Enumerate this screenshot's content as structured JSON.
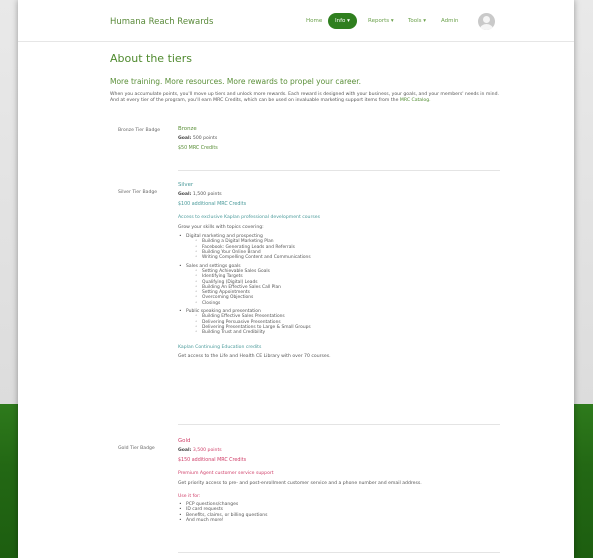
{
  "nav": {
    "brand": "Humana Reach Rewards",
    "items": [
      {
        "label": "Home"
      },
      {
        "label": "Info ▾"
      },
      {
        "label": "Reports ▾"
      },
      {
        "label": "Tools ▾"
      },
      {
        "label": "Admin"
      }
    ]
  },
  "page": {
    "title": "About the tiers",
    "subtitle": "More training. More resources. More rewards to propel your career.",
    "intro": "When you accumulate points, you'll move up tiers and unlock more rewards. Each reward is designed with your business, your goals, and your members' needs in mind. And at every tier of the program, you'll earn MRC Credits, which can be used on invaluable marketing support items from the",
    "intro_link": "MRC Catalog."
  },
  "tiers": {
    "bronze": {
      "badge": "Bronze Tier Badge",
      "name": "Bronze",
      "goal_label": "Goal:",
      "goal_value": " 500 points",
      "credits": "$50 MRC Credits"
    },
    "silver": {
      "badge": "Silver Tier Badge",
      "name": "Silver",
      "goal_label": "Goal:",
      "goal_value": " 1,500 points",
      "credits": "$100 additional MRC Credits",
      "access_link": "Access to exclusive Kaplan professional development courses",
      "grow_text": "Grow your skills with topics covering:",
      "topics": [
        {
          "name": "Digital marketing and prospecting",
          "items": [
            "Building a Digital Marketing Plan",
            "Facebook: Generating Leads and Referrals",
            "Building Your Online Brand",
            "Writing Compelling Content and Communications"
          ]
        },
        {
          "name": "Sales and settings goals",
          "items": [
            "Setting Achievable Sales Goals",
            "Identifying Targets",
            "Qualifying (Digital) Leads",
            "Building An Effective Sales Call Plan",
            "Setting Appointments",
            "Overcoming Objections",
            "Closings"
          ]
        },
        {
          "name": "Public speaking and presentation",
          "items": [
            "Building Effective Sales Presentations",
            "Delivering Persuasive Presentations",
            "Delivering Presentations to Large & Small Groups",
            "Building Trust and Credibility"
          ]
        }
      ],
      "ce_link": "Kaplan Continuing Education credits",
      "ce_text": "Get access to the Life and Health CE Library with over 70 courses."
    },
    "gold": {
      "badge": "Gold Tier Badge",
      "name": "Gold",
      "goal_label": "Goal:",
      "goal_value": " 3,500 points",
      "credits": "$150 additional MRC Credits",
      "support_link": "Premium Agent customer service support",
      "support_text": "Get priority access to pre- and post-enrollment customer service and a phone number and email address.",
      "use_label": "Use it for:",
      "uses": [
        "PCP questions/changes",
        "ID card requests",
        "Benefits, claims, or billing questions",
        "And much more!"
      ]
    }
  },
  "colors": {
    "brand_green": "#4f8a2e",
    "nav_active": "#2f7f1f",
    "silver_link": "#4a9a9a",
    "gold_link": "#d0406a"
  }
}
